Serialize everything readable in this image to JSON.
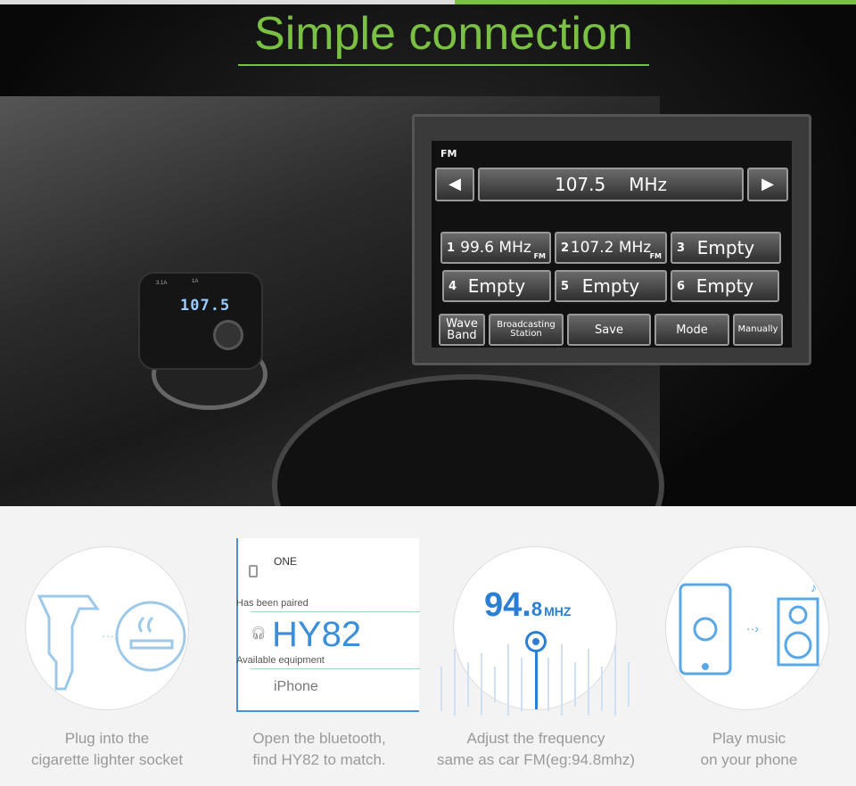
{
  "header": {
    "title": "Simple connection",
    "accent": "#7ac143"
  },
  "device": {
    "display": "107.5",
    "port1": "3.1A",
    "port2": "1A"
  },
  "radio": {
    "band": "FM",
    "frequency": "107.5",
    "unit": "MHz",
    "presets": [
      {
        "n": "1",
        "label": "99.6 MHz",
        "tag": "FM"
      },
      {
        "n": "2",
        "label": "107.2 MHz",
        "tag": "FM"
      },
      {
        "n": "3",
        "label": "Empty"
      },
      {
        "n": "4",
        "label": "Empty"
      },
      {
        "n": "5",
        "label": "Empty"
      },
      {
        "n": "6",
        "label": "Empty"
      }
    ],
    "buttons": [
      {
        "l1": "Wave",
        "l2": "Band"
      },
      {
        "l1": "Broadcasting",
        "l2": "Station"
      },
      {
        "l1": "Save"
      },
      {
        "l1": "Mode"
      },
      {
        "l1": "Manually"
      }
    ]
  },
  "steps": [
    {
      "line1": "Plug into the",
      "line2": "cigarette lighter socket",
      "icon": "car-charger-and-cigarette-icon"
    },
    {
      "line1": "Open the bluetooth,",
      "line2": "find HY82 to match.",
      "paired_label": "Has been paired",
      "paired_device": "ONE",
      "target_device": "HY82",
      "available_label": "Available equipment",
      "available_device": "iPhone"
    },
    {
      "line1": "Adjust the frequency",
      "line2": "same as car FM(eg:94.8mhz)",
      "freq_main": "94.",
      "freq_dec": "8",
      "freq_unit": "MHZ"
    },
    {
      "line1": "Play music",
      "line2": "on your phone",
      "icon": "phone-to-speaker-icon"
    }
  ]
}
